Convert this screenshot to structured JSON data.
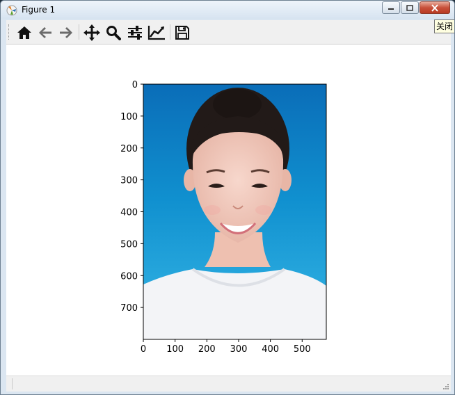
{
  "window": {
    "title": "Figure 1",
    "tooltip": "关闭"
  },
  "toolbar": {
    "buttons": [
      {
        "icon": "home-icon"
      },
      {
        "icon": "back-arrow-icon"
      },
      {
        "icon": "forward-arrow-icon"
      },
      {
        "icon": "pan-icon"
      },
      {
        "icon": "zoom-icon"
      },
      {
        "icon": "subplots-config-icon"
      },
      {
        "icon": "edit-axis-icon"
      },
      {
        "icon": "save-icon"
      }
    ]
  },
  "chart_data": {
    "type": "image",
    "xticks": [
      "0",
      "100",
      "200",
      "300",
      "400",
      "500"
    ],
    "yticks": [
      "0",
      "100",
      "200",
      "300",
      "400",
      "500",
      "600",
      "700"
    ],
    "xlim": [
      0,
      576
    ],
    "ylim": [
      800,
      0
    ]
  }
}
